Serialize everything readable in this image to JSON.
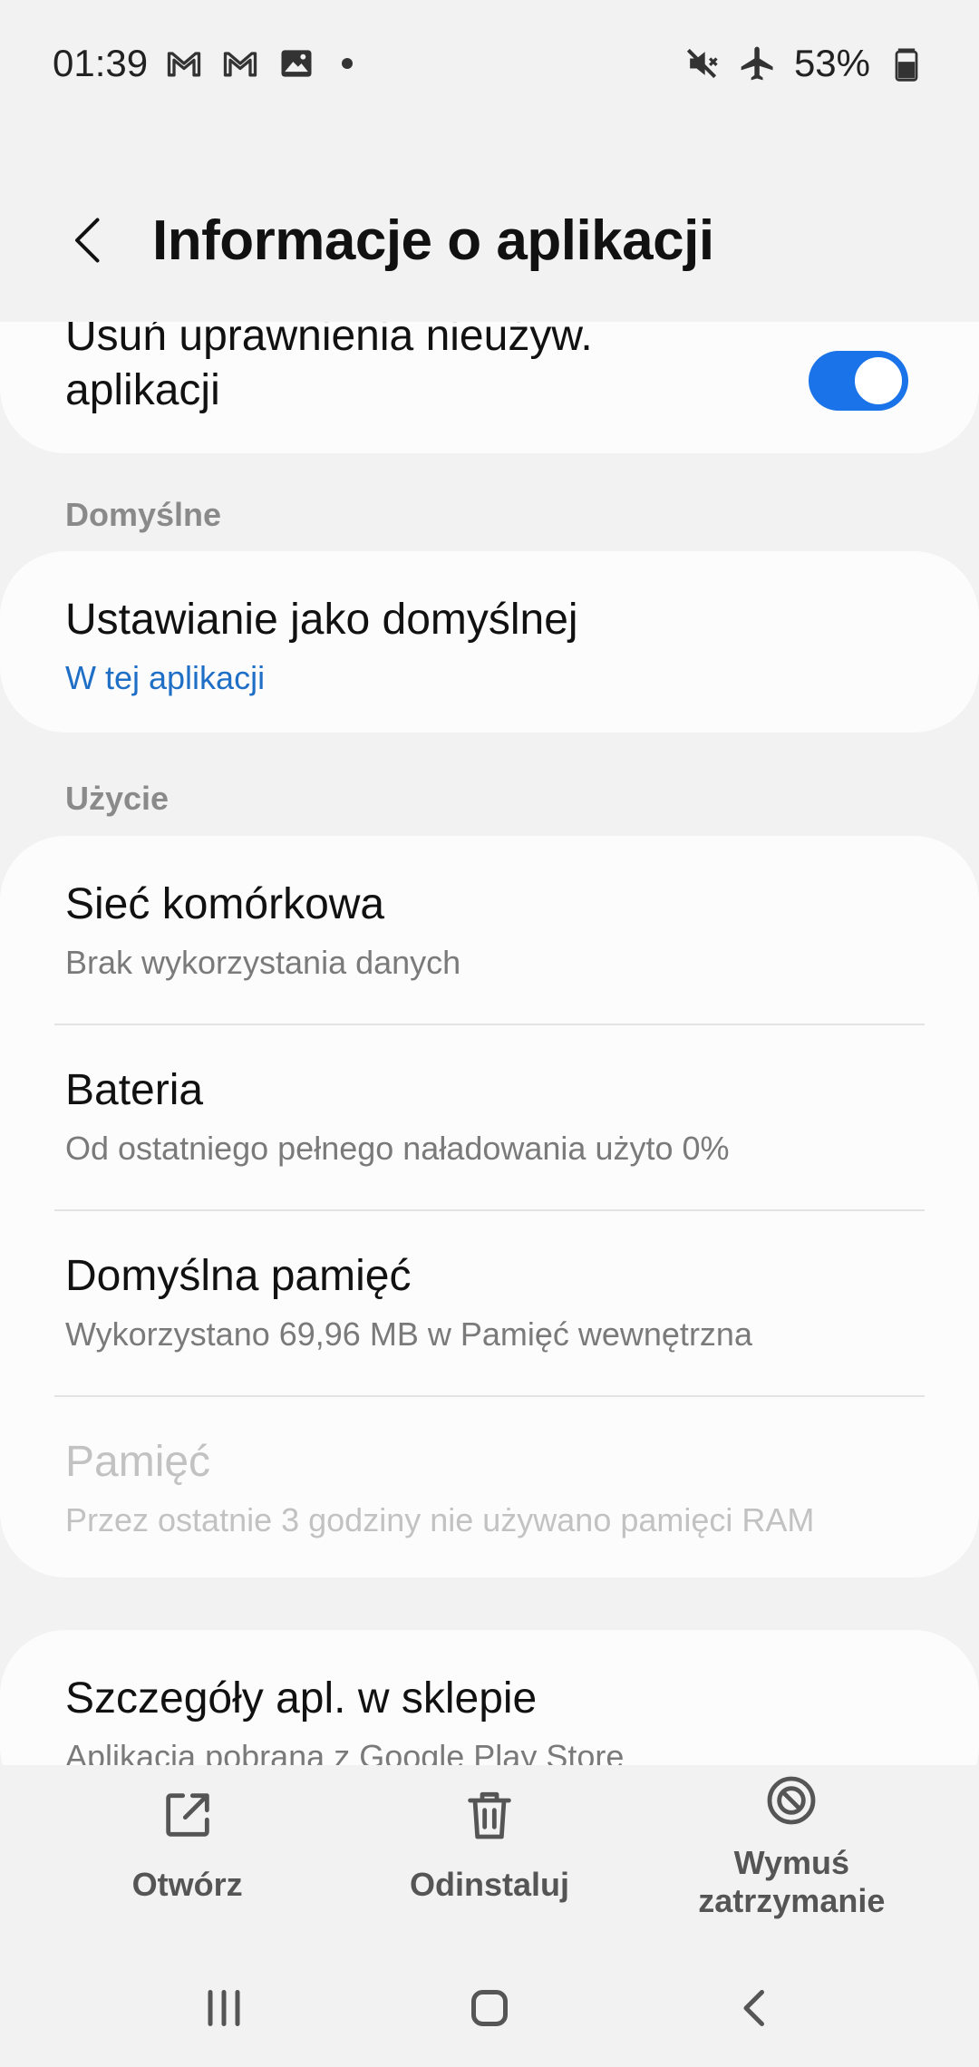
{
  "status_bar": {
    "time": "01:39",
    "battery": "53%",
    "icons_left": [
      "gmail-icon",
      "gmail-icon",
      "gallery-icon",
      "dot"
    ],
    "icons_right": [
      "mute-icon",
      "airplane-icon",
      "battery-icon"
    ]
  },
  "header": {
    "title": "Informacje o aplikacji"
  },
  "permissions": {
    "title": "Usuń uprawnienia nieużyw. aplikacji",
    "toggle_on": true
  },
  "defaults": {
    "label": "Domyślne",
    "item_title": "Ustawianie jako domyślnej",
    "item_sub": "W tej aplikacji"
  },
  "usage": {
    "label": "Użycie",
    "items": [
      {
        "title": "Sieć komórkowa",
        "sub": "Brak wykorzystania danych"
      },
      {
        "title": "Bateria",
        "sub": "Od ostatniego pełnego naładowania użyto 0%"
      },
      {
        "title": "Domyślna pamięć",
        "sub": "Wykorzystano 69,96 MB w Pamięć wewnętrzna"
      },
      {
        "title": "Pamięć",
        "sub": "Przez ostatnie 3 godziny nie używano pamięci RAM"
      }
    ]
  },
  "store": {
    "title": "Szczegóły apl. w sklepie",
    "sub": "Aplikacja pobrana z Google Play Store"
  },
  "actions": {
    "open": "Otwórz",
    "uninstall": "Odinstaluj",
    "force_stop": "Wymuś zatrzymanie"
  },
  "colors": {
    "accent": "#1a73e8",
    "link": "#1f6fc6",
    "background": "#f2f2f2",
    "card": "#fcfcfc"
  }
}
